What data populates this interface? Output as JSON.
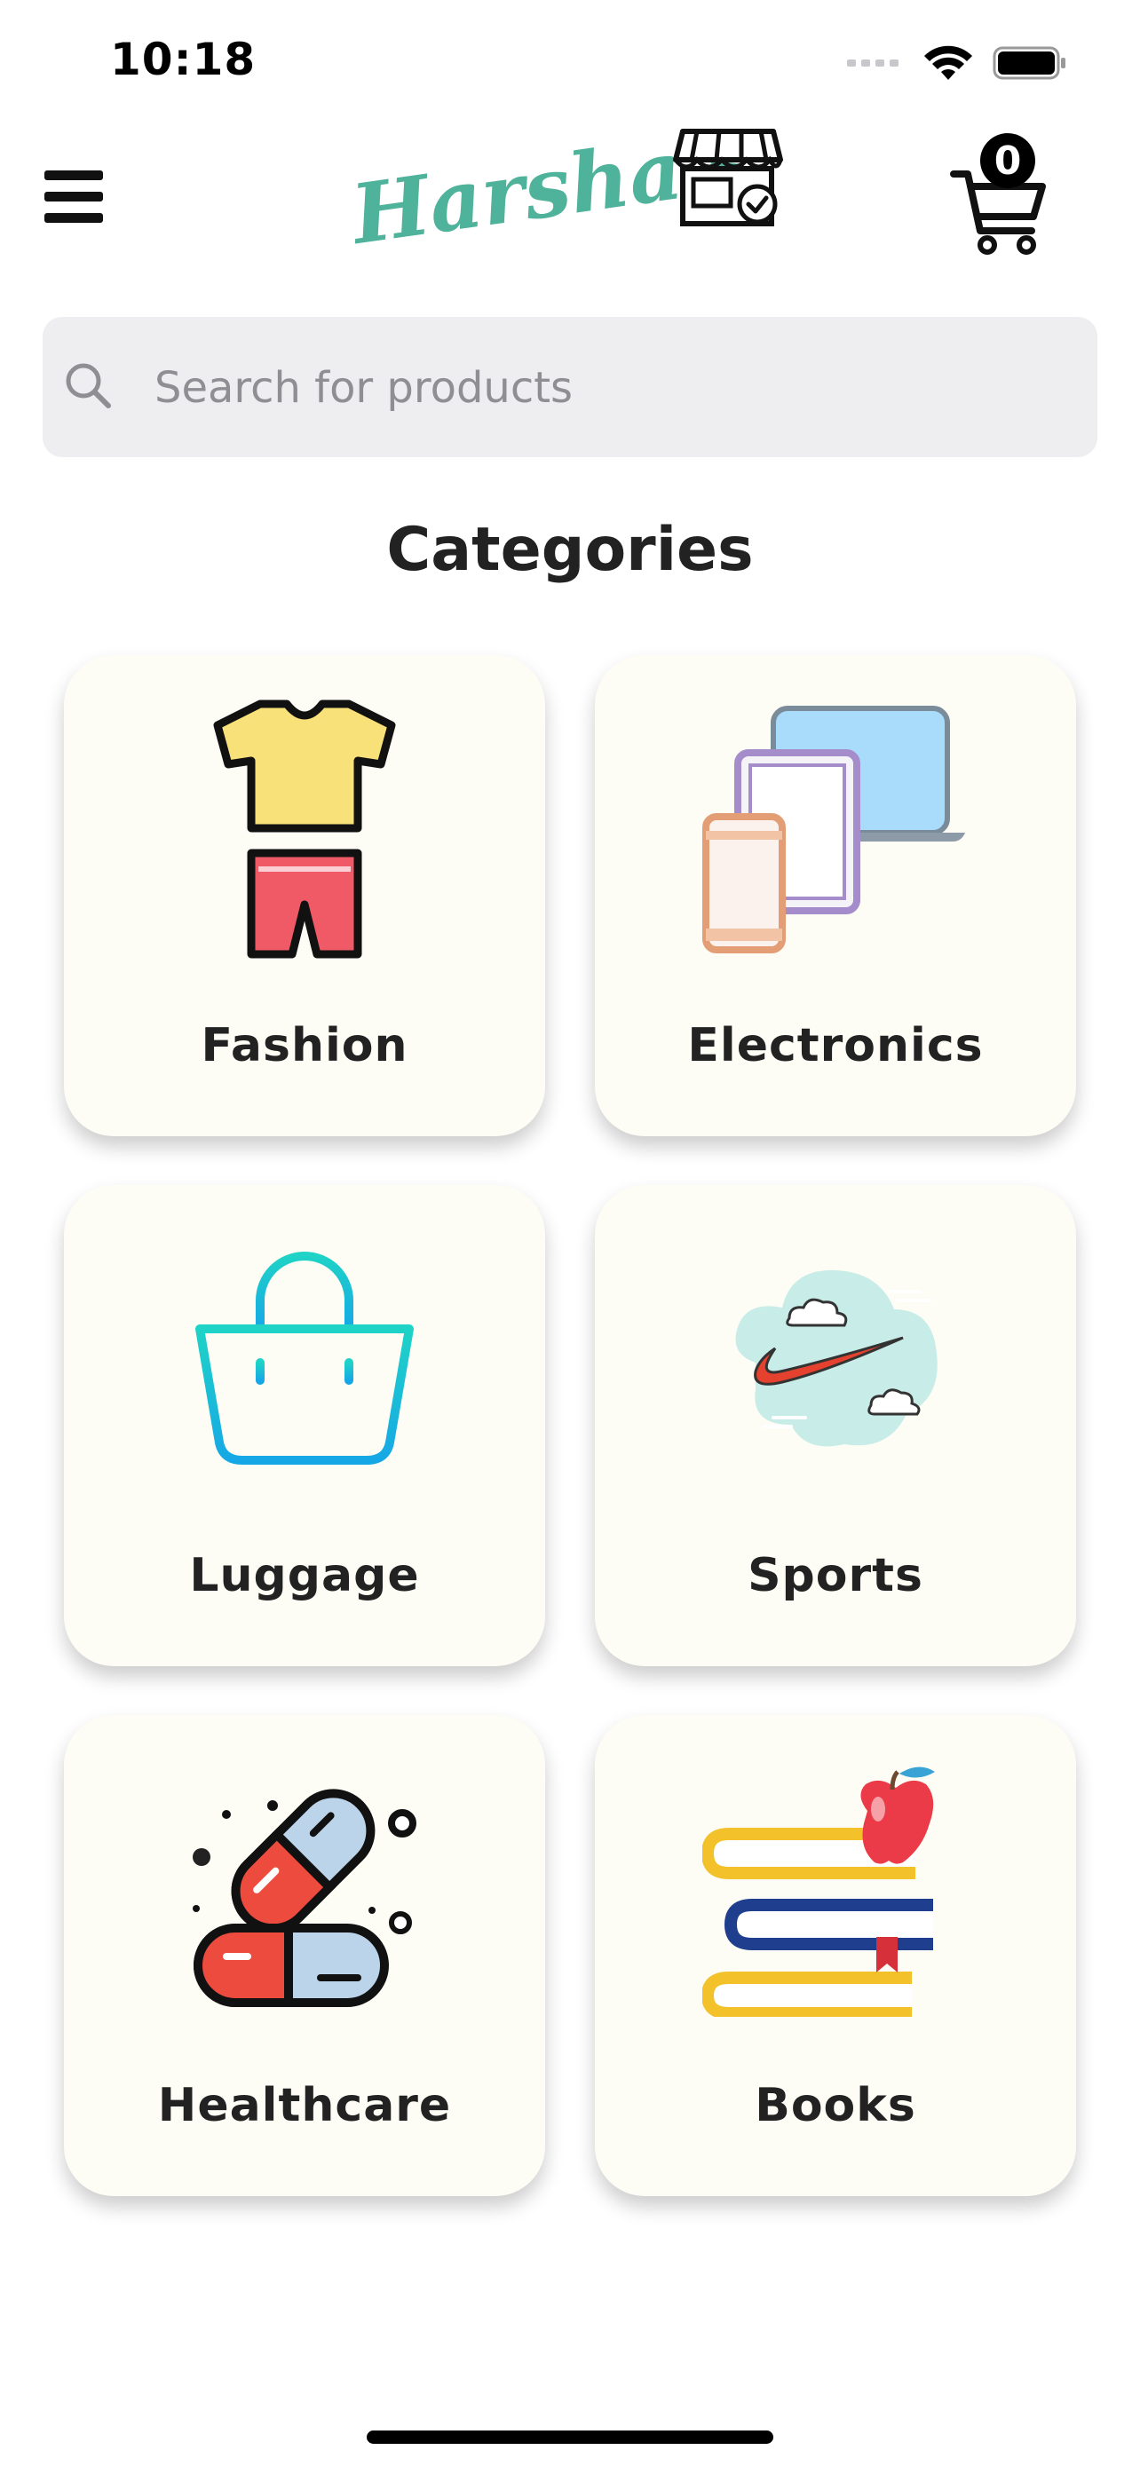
{
  "status_bar": {
    "time": "10:18",
    "icons": [
      "cellular-icon",
      "wifi-icon",
      "battery-icon"
    ]
  },
  "header": {
    "menu_icon": "hamburger-menu-icon",
    "logo_text": "Harsha's",
    "logo_icon": "store-icon",
    "cart_icon": "cart-icon",
    "cart_count": "0"
  },
  "search": {
    "placeholder": "Search for products",
    "value": ""
  },
  "categories": {
    "title": "Categories",
    "items": [
      {
        "label": "Fashion",
        "icon": "clothes-icon"
      },
      {
        "label": "Electronics",
        "icon": "devices-icon"
      },
      {
        "label": "Luggage",
        "icon": "bag-icon"
      },
      {
        "label": "Sports",
        "icon": "swoosh-icon"
      },
      {
        "label": "Healthcare",
        "icon": "pills-icon"
      },
      {
        "label": "Books",
        "icon": "books-apple-icon"
      }
    ]
  },
  "colors": {
    "brand": "#4fb39b",
    "card_background": "#fdfdf5",
    "search_background": "#eeeef0",
    "placeholder": "#8e8e93"
  }
}
